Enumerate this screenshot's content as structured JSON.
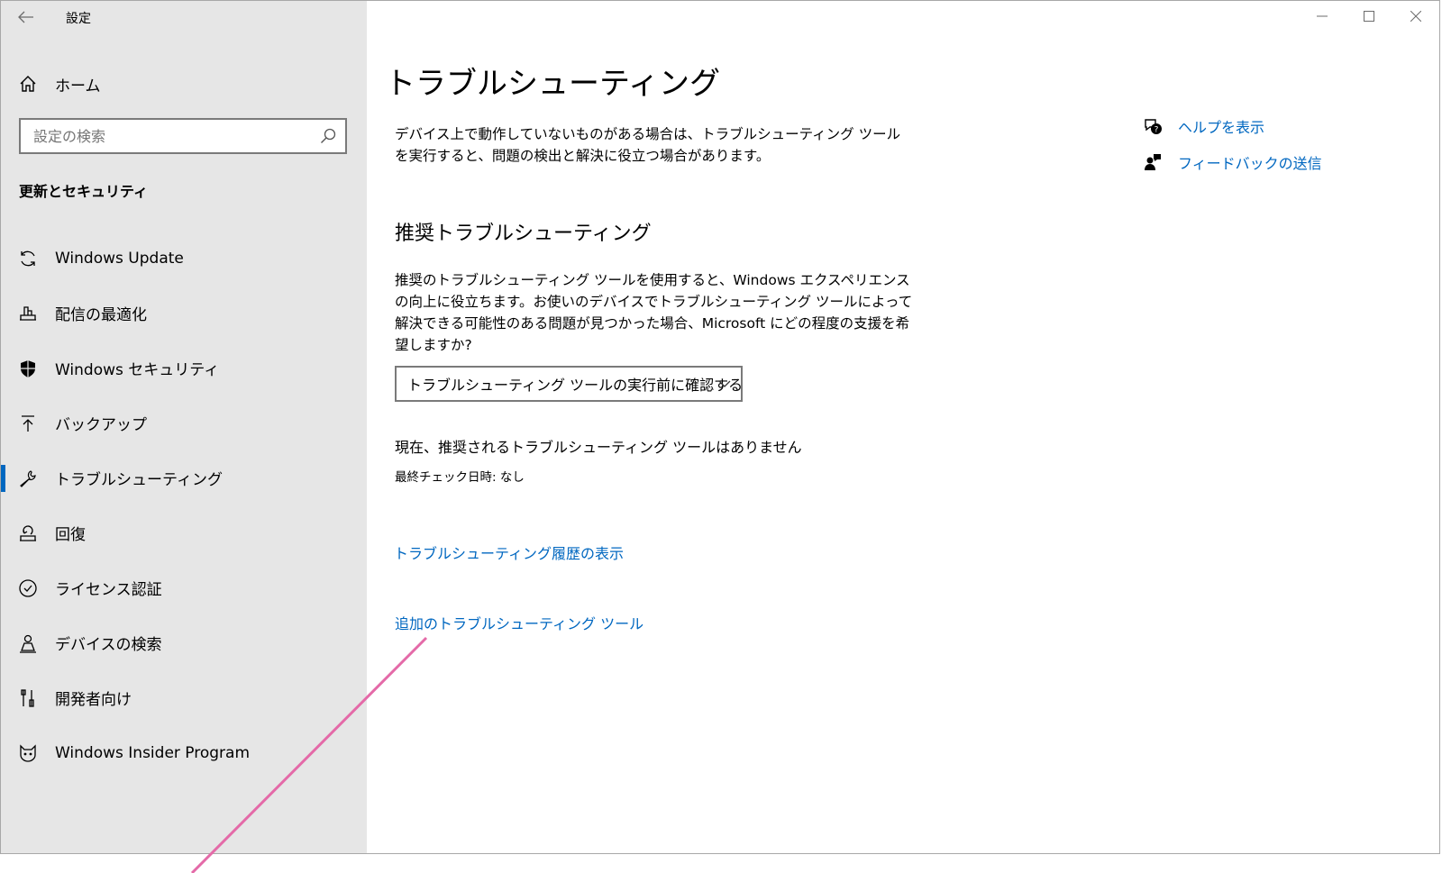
{
  "app": {
    "title": "設定"
  },
  "sidebar": {
    "home_label": "ホーム",
    "search_placeholder": "設定の検索",
    "section_heading": "更新とセキュリティ",
    "items": [
      {
        "label": "Windows Update",
        "icon": "sync-icon"
      },
      {
        "label": "配信の最適化",
        "icon": "delivery-optimization-icon"
      },
      {
        "label": "Windows セキュリティ",
        "icon": "shield-icon"
      },
      {
        "label": "バックアップ",
        "icon": "upload-arrow-icon"
      },
      {
        "label": "トラブルシューティング",
        "icon": "wrench-icon",
        "selected": true
      },
      {
        "label": "回復",
        "icon": "recovery-icon"
      },
      {
        "label": "ライセンス認証",
        "icon": "check-circle-icon"
      },
      {
        "label": "デバイスの検索",
        "icon": "person-location-icon"
      },
      {
        "label": "開発者向け",
        "icon": "developer-tools-icon"
      },
      {
        "label": "Windows Insider Program",
        "icon": "insider-cat-icon"
      }
    ]
  },
  "main": {
    "title": "トラブルシューティング",
    "description": "デバイス上で動作していないものがある場合は、トラブルシューティング ツールを実行すると、問題の検出と解決に役立つ場合があります。",
    "recommended_heading": "推奨トラブルシューティング",
    "recommended_description": "推奨のトラブルシューティング ツールを使用すると、Windows エクスペリエンスの向上に役立ちます。お使いのデバイスでトラブルシューティング ツールによって解決できる可能性のある問題が見つかった場合、Microsoft にどの程度の支援を希望しますか?",
    "dropdown_value": "トラブルシューティング ツールの実行前に確認する",
    "status_text": "現在、推奨されるトラブルシューティング ツールはありません",
    "last_check": "最終チェック日時: なし",
    "history_link": "トラブルシューティング履歴の表示",
    "additional_link": "追加のトラブルシューティング ツール"
  },
  "side_links": {
    "help": "ヘルプを表示",
    "feedback": "フィードバックの送信"
  },
  "colors": {
    "sidebar_bg": "#e6e6e6",
    "accent": "#0067c0",
    "annotation": "#e46aa8"
  }
}
